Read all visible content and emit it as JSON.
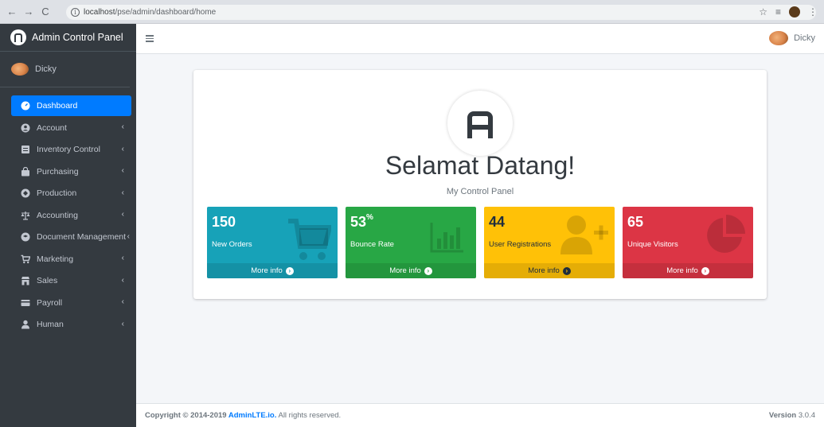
{
  "browser": {
    "url_host": "localhost",
    "url_path": "/pse/admin/dashboard/home"
  },
  "sidebar": {
    "brand": "Admin Control Panel",
    "user": "Dicky",
    "items": [
      {
        "label": "Dashboard",
        "icon": "tachometer-icon",
        "active": true
      },
      {
        "label": "Account",
        "icon": "user-circle-icon"
      },
      {
        "label": "Inventory Control",
        "icon": "inventory-icon"
      },
      {
        "label": "Purchasing",
        "icon": "shopping-bag-icon"
      },
      {
        "label": "Production",
        "icon": "production-icon"
      },
      {
        "label": "Accounting",
        "icon": "balance-scale-icon"
      },
      {
        "label": "Document Management",
        "icon": "document-icon"
      },
      {
        "label": "Marketing",
        "icon": "cart-icon"
      },
      {
        "label": "Sales",
        "icon": "store-icon"
      },
      {
        "label": "Payroll",
        "icon": "credit-card-icon"
      },
      {
        "label": "Human",
        "icon": "person-icon"
      }
    ]
  },
  "topbar": {
    "user": "Dicky"
  },
  "main": {
    "title": "Selamat Datang!",
    "subtitle": "My Control Panel",
    "boxes": [
      {
        "value": "150",
        "suffix": "",
        "label": "New Orders",
        "footer": "More info",
        "icon": "shopping-cart-icon",
        "color": "#17a2b8"
      },
      {
        "value": "53",
        "suffix": "%",
        "label": "Bounce Rate",
        "footer": "More info",
        "icon": "bar-chart-icon",
        "color": "#28a745"
      },
      {
        "value": "44",
        "suffix": "",
        "label": "User Registrations",
        "footer": "More info",
        "icon": "user-plus-icon",
        "color": "#ffc107"
      },
      {
        "value": "65",
        "suffix": "",
        "label": "Unique Visitors",
        "footer": "More info",
        "icon": "pie-chart-icon",
        "color": "#dc3545"
      }
    ]
  },
  "footer": {
    "copyright_prefix": "Copyright © 2014-2019 ",
    "copyright_link": "AdminLTE.io.",
    "copyright_suffix": " All rights reserved.",
    "version_label": "Version",
    "version_value": "3.0.4"
  }
}
